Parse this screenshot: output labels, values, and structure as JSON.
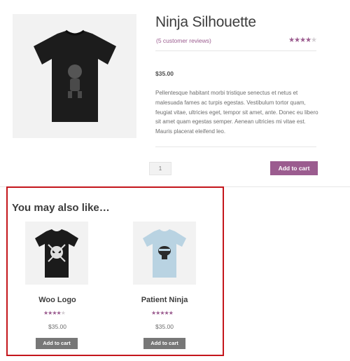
{
  "product": {
    "title": "Ninja Silhouette",
    "reviews_link": "(5 customer reviews)",
    "rating": 4,
    "price": "$35.00",
    "description": "Pellentesque habitant morbi tristique senectus et netus et malesuada fames ac turpis egestas. Vestibulum tortor quam, feugiat vitae, ultricies eget, tempor sit amet, ante. Donec eu libero sit amet quam egestas semper. Aenean ultricies mi vitae est. Mauris placerat eleifend leo.",
    "quantity": "1",
    "add_to_cart": "Add to cart"
  },
  "related": {
    "heading": "You may also like…",
    "items": [
      {
        "name": "Woo Logo",
        "price": "$35.00",
        "rating": 4,
        "button": "Add to cart",
        "icon": "black-tshirt-skull-logo"
      },
      {
        "name": "Patient Ninja",
        "price": "$35.00",
        "rating": 5,
        "button": "Add to cart",
        "icon": "light-blue-tshirt-ninja"
      }
    ]
  },
  "colors": {
    "accent": "#9b5c8f",
    "highlight_border": "#c4161c",
    "secondary_button": "#777777"
  }
}
